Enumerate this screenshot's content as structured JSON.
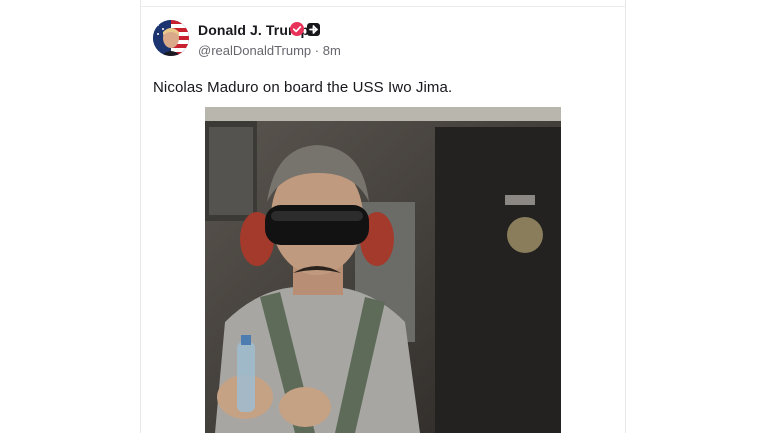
{
  "post": {
    "author_name": "Donald J. Trump",
    "handle": "@realDonaldTrump",
    "separator": "·",
    "time_ago": "8m",
    "text": "Nicolas Maduro on board the USS Iwo Jima."
  },
  "icons": {
    "avatar": "avatar-flag-portrait",
    "verified": "verified-badge-icon",
    "plus": "plus-badge-icon"
  },
  "colors": {
    "verified": "#e8325a",
    "text_primary": "#17171c",
    "text_secondary": "#66666e"
  }
}
